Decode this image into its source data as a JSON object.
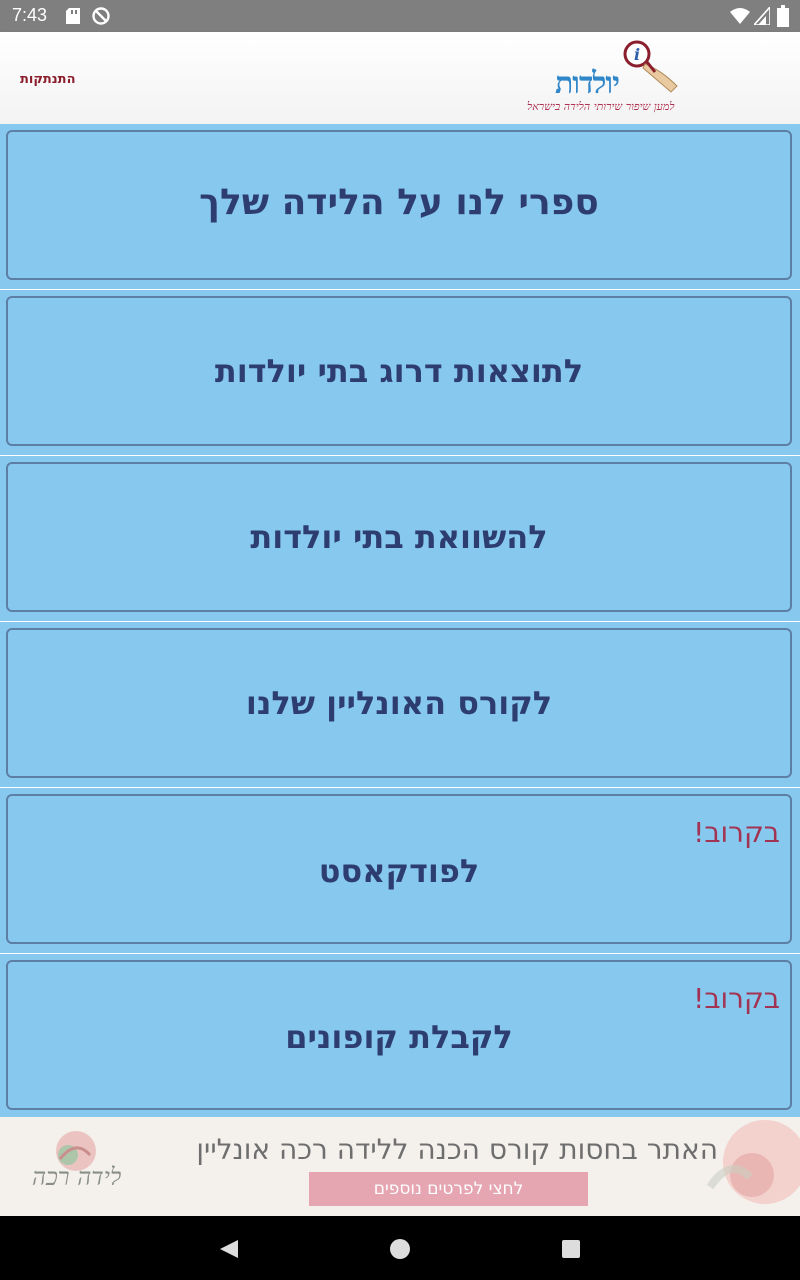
{
  "status_bar": {
    "time": "7:43",
    "icons": [
      "sd-card-icon",
      "do-not-disturb-icon",
      "wifi-icon",
      "signal-icon",
      "battery-icon"
    ]
  },
  "header": {
    "logout_label": "התנתקות",
    "logo": {
      "brand": "יולדות",
      "tagline": "למען שיפור שירותי הלידה בישראל"
    }
  },
  "menu": {
    "items": [
      {
        "label": "ספרי לנו על הלידה שלך",
        "badge": ""
      },
      {
        "label": "לתוצאות דרוג בתי יולדות",
        "badge": ""
      },
      {
        "label": "להשוואת בתי יולדות",
        "badge": ""
      },
      {
        "label": "לקורס האונליין שלנו",
        "badge": ""
      },
      {
        "label": "לפודקאסט",
        "badge": "בקרוב!"
      },
      {
        "label": "לקבלת קופונים",
        "badge": "בקרוב!"
      }
    ]
  },
  "banner": {
    "headline": "האתר בחסות קורס הכנה ללידה רכה אונליין",
    "cta": "לחצי לפרטים נוספים",
    "logo_text": "לידה רכה"
  },
  "nav_bar": {
    "icons": [
      "back-icon",
      "home-icon",
      "recents-icon"
    ]
  },
  "colors": {
    "status_bar": "#7f7f7f",
    "card_fill": "#87c8ee",
    "card_border": "#5e7fa5",
    "card_text": "#2d3d70",
    "badge_text": "#a23352",
    "logout_text": "#8b1e2c",
    "banner_cta": "#e5a6b2"
  }
}
